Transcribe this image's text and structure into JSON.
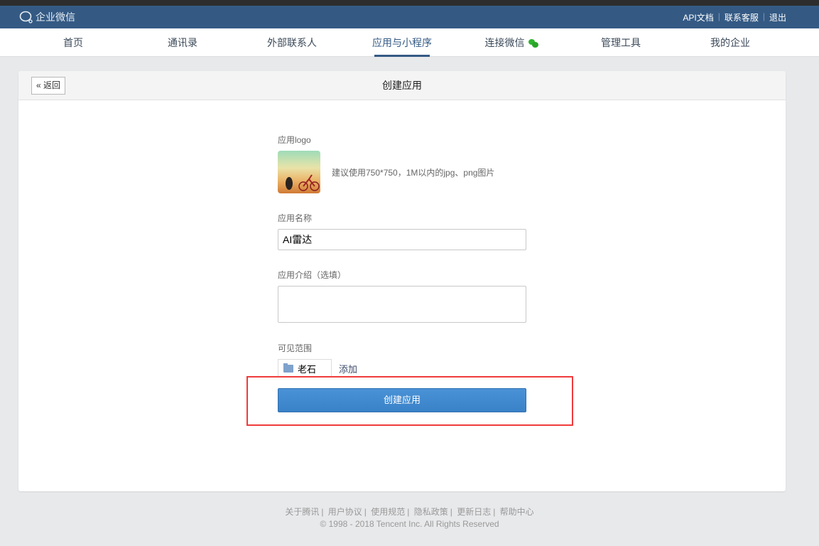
{
  "header": {
    "logo_text": "企业微信",
    "links": [
      "API文档",
      "联系客服",
      "退出"
    ]
  },
  "nav": {
    "items": [
      "首页",
      "通讯录",
      "外部联系人",
      "应用与小程序",
      "连接微信",
      "管理工具",
      "我的企业"
    ],
    "active": "应用与小程序"
  },
  "card": {
    "back_label": "返回",
    "title": "创建应用"
  },
  "form": {
    "logo_label": "应用logo",
    "logo_hint": "建议使用750*750，1M以内的jpg、png图片",
    "name_label": "应用名称",
    "name_value": "AI雷达",
    "desc_label": "应用介绍（选填）",
    "desc_value": "",
    "scope_label": "可见范围",
    "scope_tag": "老石",
    "add_label": "添加",
    "submit_label": "创建应用"
  },
  "footer": {
    "links": [
      "关于腾讯",
      "用户协议",
      "使用规范",
      "隐私政策",
      "更新日志",
      "帮助中心"
    ],
    "copyright": "© 1998 - 2018 Tencent Inc. All Rights Reserved"
  },
  "colors": {
    "header": "#345a84",
    "button": "#3a82c8",
    "highlight": "#f03b3b"
  }
}
